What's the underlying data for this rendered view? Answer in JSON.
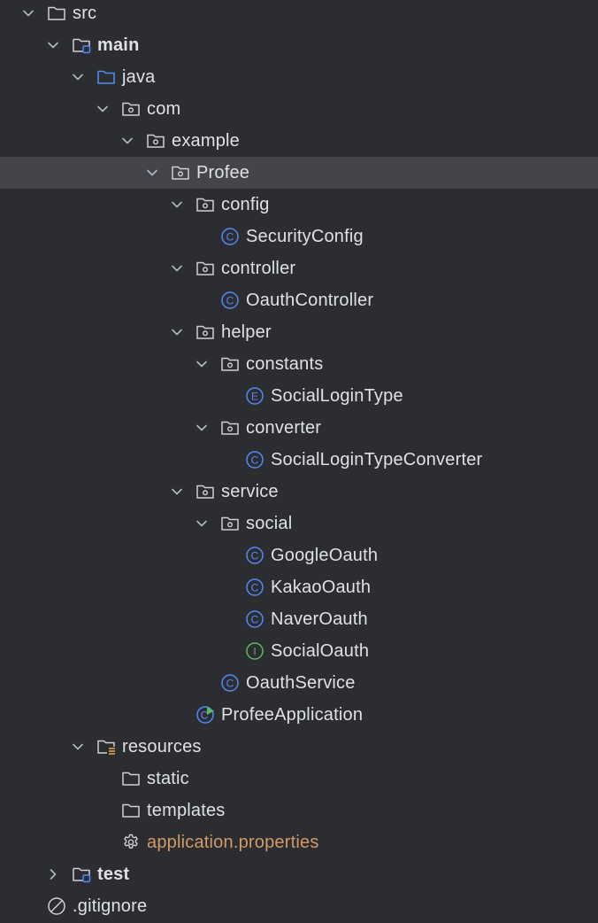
{
  "tree": [
    {
      "label": "src",
      "icon": "folder-icon",
      "expanded": true
    },
    {
      "label": "main",
      "icon": "source-root-folder-icon",
      "expanded": true
    },
    {
      "label": "java",
      "icon": "java-source-folder-icon",
      "expanded": true
    },
    {
      "label": "com",
      "icon": "package-icon",
      "expanded": true
    },
    {
      "label": "example",
      "icon": "package-icon",
      "expanded": true
    },
    {
      "label": "Profee",
      "icon": "package-icon",
      "expanded": true,
      "selected": true
    },
    {
      "label": "config",
      "icon": "package-icon",
      "expanded": true
    },
    {
      "label": "SecurityConfig",
      "icon": "class-icon"
    },
    {
      "label": "controller",
      "icon": "package-icon",
      "expanded": true
    },
    {
      "label": "OauthController",
      "icon": "class-icon"
    },
    {
      "label": "helper",
      "icon": "package-icon",
      "expanded": true
    },
    {
      "label": "constants",
      "icon": "package-icon",
      "expanded": true
    },
    {
      "label": "SocialLoginType",
      "icon": "enum-icon"
    },
    {
      "label": "converter",
      "icon": "package-icon",
      "expanded": true
    },
    {
      "label": "SocialLoginTypeConverter",
      "icon": "class-icon"
    },
    {
      "label": "service",
      "icon": "package-icon",
      "expanded": true
    },
    {
      "label": "social",
      "icon": "package-icon",
      "expanded": true
    },
    {
      "label": "GoogleOauth",
      "icon": "class-icon"
    },
    {
      "label": "KakaoOauth",
      "icon": "class-icon"
    },
    {
      "label": "NaverOauth",
      "icon": "class-icon"
    },
    {
      "label": "SocialOauth",
      "icon": "interface-icon"
    },
    {
      "label": "OauthService",
      "icon": "class-icon"
    },
    {
      "label": "ProfeeApplication",
      "icon": "spring-boot-class-icon"
    },
    {
      "label": "resources",
      "icon": "resources-folder-icon",
      "expanded": true
    },
    {
      "label": "static",
      "icon": "folder-icon"
    },
    {
      "label": "templates",
      "icon": "folder-icon"
    },
    {
      "label": "application.properties",
      "icon": "gear-icon"
    },
    {
      "label": "test",
      "icon": "test-root-folder-icon",
      "expanded": false
    },
    {
      "label": ".gitignore",
      "icon": "ignored-file-icon"
    }
  ],
  "colors": {
    "background": "#2b2d30",
    "selected_row": "#43454a",
    "text": "#dfe1e5",
    "modified_file_text": "#d19a66",
    "class_icon": "#548af7",
    "interface_icon": "#5fb865"
  }
}
